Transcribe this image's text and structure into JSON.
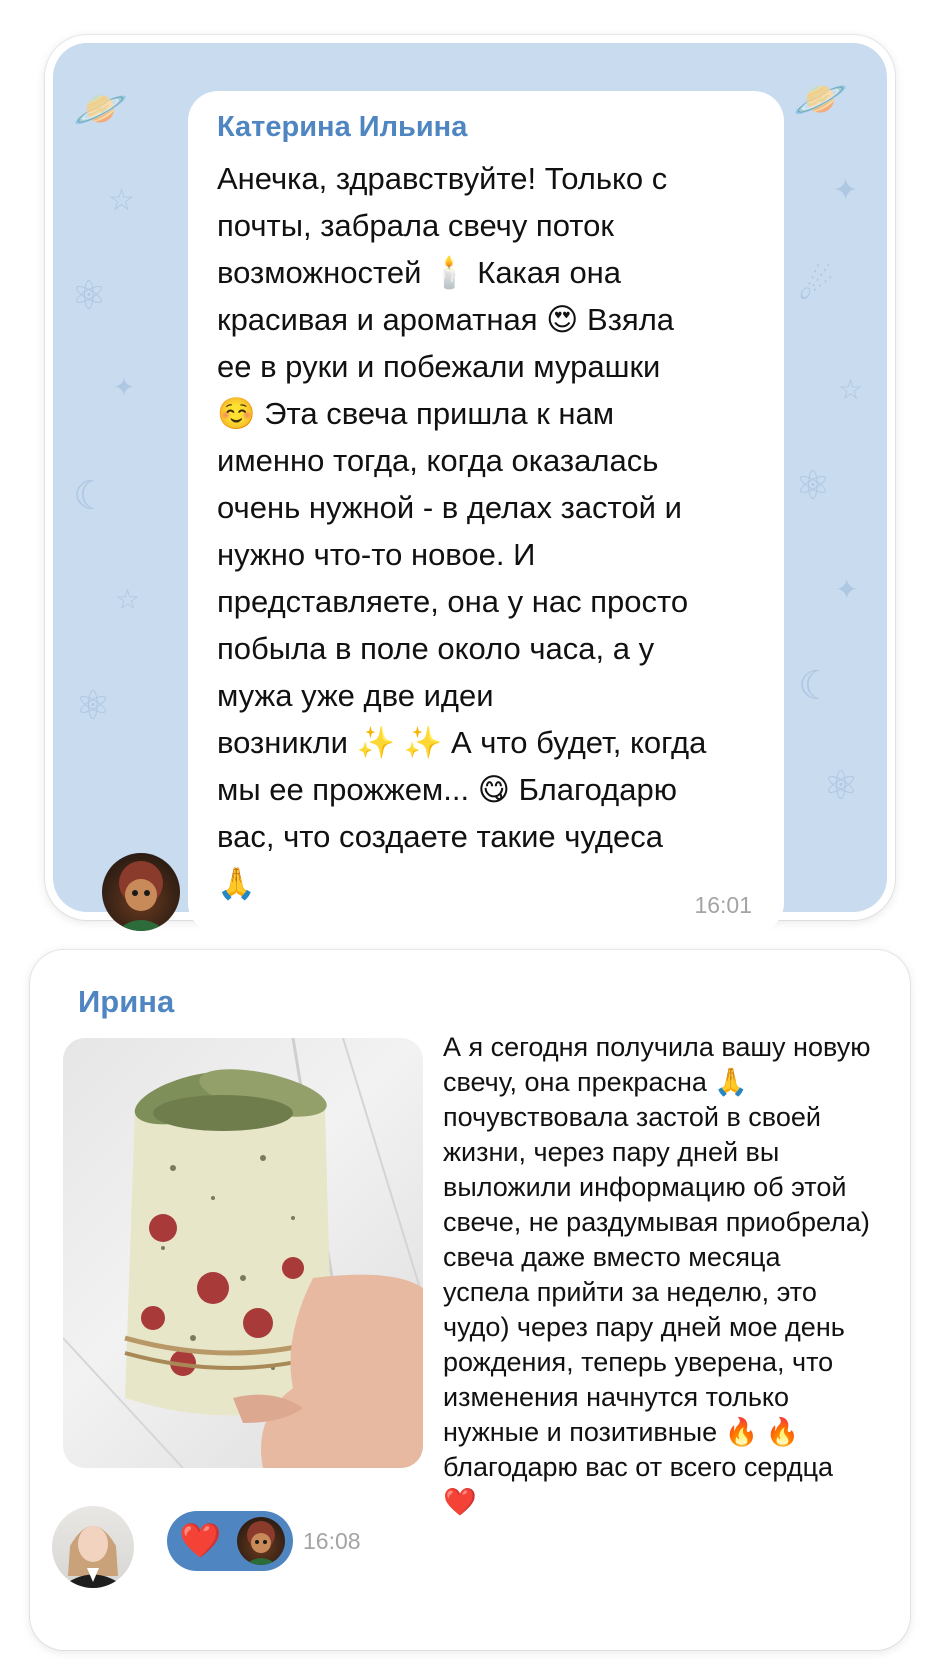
{
  "review1": {
    "sender": "Катерина Ильина",
    "message": "Анечка, здравствуйте! Только с\nпочты, забрала свечу поток\nвозможностей 🕯️ Какая она\nкрасивая и ароматная 😍 Взяла\nее в руки и побежали мурашки\n☺️ Эта свеча пришла к нам\nименно тогда, когда оказалась\nочень нужной - в делах застой и\nнужно что-то новое. И\nпредставляете, она у нас просто\nпобыла в поле около часа, а у\nмужа уже две идеи\nвозникли ✨ ✨ А что будет, когда\nмы ее прожжем... 😋 Благодарю\nвас, что создаете такие чудеса\n🙏",
    "time": "16:01",
    "chat_background_color": "#c8dbef"
  },
  "review2": {
    "sender": "Ирина",
    "message": "А я сегодня получила вашу новую\nсвечу, она прекрасна 🙏\nпочувствовала застой в своей\nжизни, через пару дней вы\nвыложили информацию об этой\nсвече, не раздумывая приобрела)\nсвеча даже вместо месяца\nуспела прийти за неделю, это\nчудо) через пару дней мое день\nрождения, теперь уверена, что\nизменения начнутся только\nнужные и позитивные 🔥 🔥\nблагодарю вас от всего сердца\n❤️",
    "time": "16:08",
    "reaction": "❤️",
    "photo_subject": "candle-with-dried-leaves-and-rose-petals"
  },
  "colors": {
    "accent": "#4f86c2",
    "timestamp": "#a4a4a4",
    "text": "#111111"
  }
}
